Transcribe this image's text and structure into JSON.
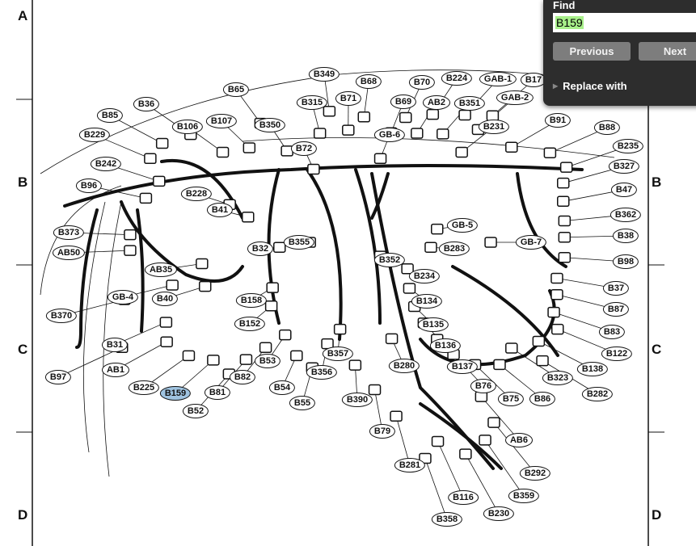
{
  "zones": {
    "left": [
      "A",
      "B",
      "C",
      "D"
    ],
    "right": [
      "B",
      "C",
      "D"
    ]
  },
  "connector_labels": [
    "B349",
    "B65",
    "B68",
    "B70",
    "B224",
    "GAB-1",
    "B17",
    "B36",
    "B85",
    "B106",
    "B107",
    "B315",
    "B71",
    "B69",
    "AB2",
    "B351",
    "GAB-2",
    "B350",
    "B91",
    "B88",
    "B231",
    "B229",
    "GB-6",
    "B72",
    "B235",
    "B242",
    "B327",
    "B96",
    "B228",
    "B47",
    "B41",
    "GB-5",
    "B362",
    "B373",
    "B38",
    "AB50",
    "B32",
    "B355",
    "B283",
    "GB-7",
    "AB35",
    "B352",
    "B98",
    "B234",
    "GB-4",
    "B40",
    "B158",
    "B37",
    "B370",
    "B134",
    "B87",
    "B152",
    "B135",
    "B83",
    "B31",
    "B136",
    "B357",
    "B122",
    "B53",
    "B137",
    "B138",
    "AB1",
    "B280",
    "B323",
    "B97",
    "B356",
    "B76",
    "B82",
    "B54",
    "B282",
    "B225",
    "B159",
    "B81",
    "B75",
    "B86",
    "B55",
    "B390",
    "B52",
    "B79",
    "AB6",
    "B281",
    "B292",
    "B116",
    "B359",
    "B230",
    "B358"
  ],
  "highlighted_label": "B159",
  "highlight_color": "#9fc3e0",
  "find_panel": {
    "title": "Find",
    "query": "B159",
    "previous_label": "Previous",
    "next_label": "Next",
    "replace_label": "Replace with"
  }
}
